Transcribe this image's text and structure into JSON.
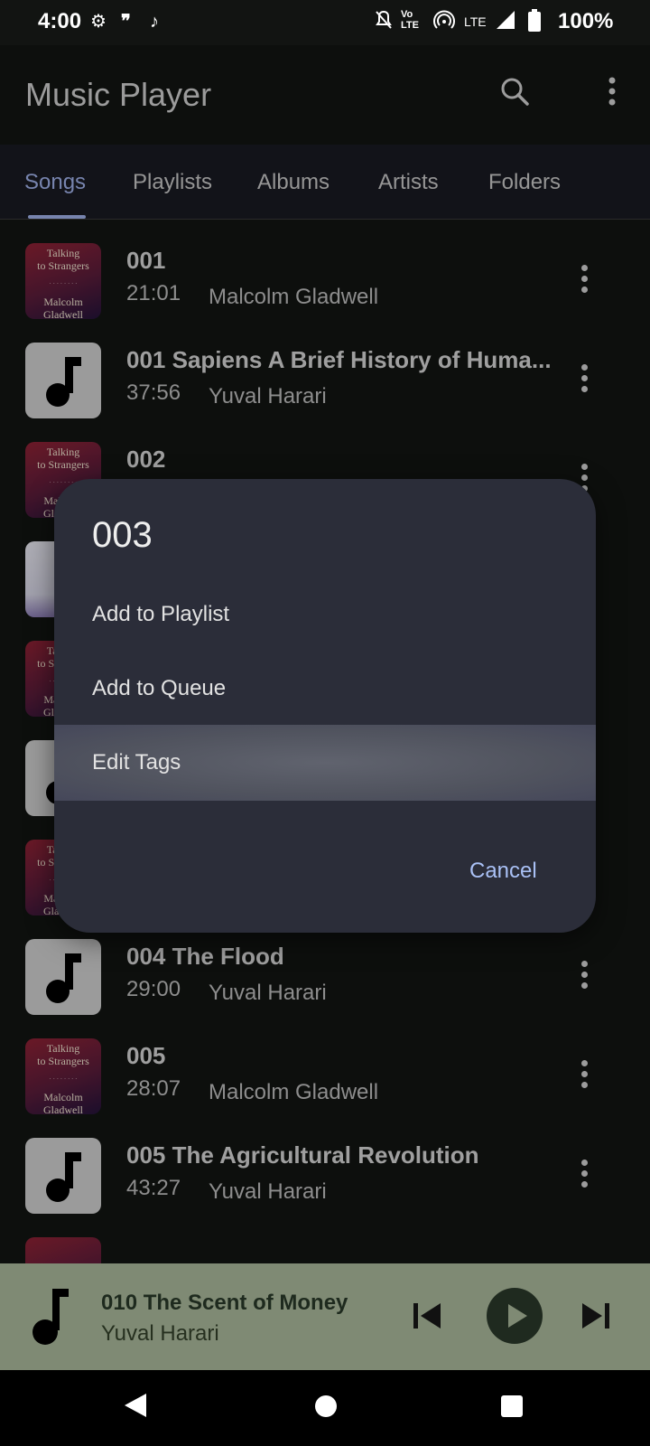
{
  "status_bar": {
    "time": "4:00",
    "network": "LTE",
    "battery": "100%",
    "icons": [
      "settings-icon",
      "quote-icon",
      "music-note-icon",
      "mute-icon",
      "volte-icon",
      "hotspot-icon",
      "signal-icon",
      "battery-icon"
    ]
  },
  "app_bar": {
    "title": "Music Player",
    "search_icon": "search-icon",
    "more_icon": "more-vert-icon"
  },
  "tabs": {
    "items": [
      {
        "label": "Songs",
        "active": true
      },
      {
        "label": "Playlists",
        "active": false
      },
      {
        "label": "Albums",
        "active": false
      },
      {
        "label": "Artists",
        "active": false
      },
      {
        "label": "Folders",
        "active": false
      }
    ]
  },
  "songs": [
    {
      "title": "001",
      "duration": "21:01",
      "artist": "Malcolm Gladwell",
      "art": "book-cover"
    },
    {
      "title": "001 Sapiens A Brief History of Huma...",
      "duration": "37:56",
      "artist": "Yuval Harari",
      "art": "music-note"
    },
    {
      "title": "002",
      "duration": "",
      "artist": "",
      "art": "book-cover"
    },
    {
      "title": "",
      "duration": "",
      "artist": "",
      "art": "light-cover"
    },
    {
      "title": "",
      "duration": "",
      "artist": "",
      "art": "book-cover"
    },
    {
      "title": "",
      "duration": "",
      "artist": "",
      "art": "music-note"
    },
    {
      "title": "",
      "duration": "",
      "artist": "",
      "art": "book-cover"
    },
    {
      "title": "004 The Flood",
      "duration": "29:00",
      "artist": "Yuval Harari",
      "art": "music-note"
    },
    {
      "title": "005",
      "duration": "28:07",
      "artist": "Malcolm Gladwell",
      "art": "book-cover"
    },
    {
      "title": "005 The Agricultural Revolution",
      "duration": "43:27",
      "artist": "Yuval Harari",
      "art": "music-note"
    }
  ],
  "book_cover": {
    "title_line1": "Talking",
    "title_line2": "to Strangers",
    "author_line1": "Malcolm",
    "author_line2": "Gladwell"
  },
  "dialog": {
    "title": "003",
    "items": [
      {
        "label": "Add to Playlist"
      },
      {
        "label": "Add to Queue"
      },
      {
        "label": "Edit Tags",
        "highlighted": true
      }
    ],
    "cancel_label": "Cancel"
  },
  "mini_player": {
    "title": "010 The Scent of Money",
    "artist": "Yuval Harari",
    "state": "paused"
  },
  "colors": {
    "background": "#121412",
    "tab_active": "#9fb0e8",
    "dialog_bg": "#2b2d39",
    "dialog_accent": "#a9c0f5",
    "mini_player_bg": "#7f8a74",
    "cover_red": "#8e2234"
  }
}
